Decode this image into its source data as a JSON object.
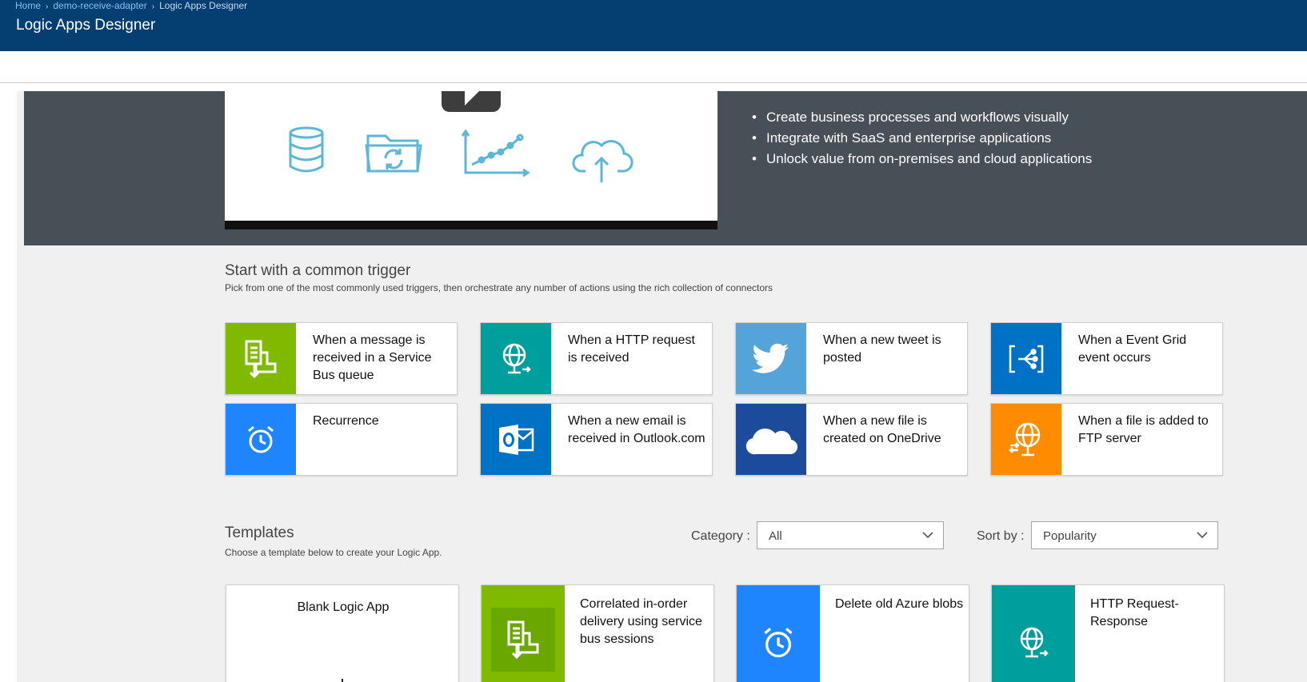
{
  "header": {
    "breadcrumb": [
      {
        "label": "Home"
      },
      {
        "label": "demo-receive-adapter"
      },
      {
        "label": "Logic Apps Designer"
      }
    ],
    "separator": "›",
    "title": "Logic Apps Designer"
  },
  "hero": {
    "bullets": [
      "Create business processes and workflows visually",
      "Integrate with SaaS and enterprise applications",
      "Unlock value from on-premises and cloud applications"
    ],
    "video_icons": [
      "database-icon",
      "folder-sync-icon",
      "chart-line-icon",
      "cloud-upload-icon"
    ],
    "icon_color": "#5bb7d6"
  },
  "triggers": {
    "title": "Start with a common trigger",
    "subtitle": "Pick from one of the most commonly used triggers, then orchestrate any number of actions using the rich collection of connectors",
    "items": [
      {
        "label": "When a message is received in a Service Bus queue",
        "icon": "service-bus-icon",
        "color": "#7fba00"
      },
      {
        "label": "When a HTTP request is received",
        "icon": "http-globe-icon",
        "color": "#009e9c"
      },
      {
        "label": "When a new tweet is posted",
        "icon": "twitter-icon",
        "color": "#55a4d9"
      },
      {
        "label": "When a Event Grid event occurs",
        "icon": "event-grid-icon",
        "color": "#0072c6"
      },
      {
        "label": "Recurrence",
        "icon": "alarm-clock-icon",
        "color": "#1f85ff"
      },
      {
        "label": "When a new email is received in Outlook.com",
        "icon": "outlook-icon",
        "color": "#0072c6"
      },
      {
        "label": "When a new file is created on OneDrive",
        "icon": "onedrive-cloud-icon",
        "color": "#1c4b9c"
      },
      {
        "label": "When a file is added to FTP server",
        "icon": "ftp-globe-icon",
        "color": "#ff8c00"
      }
    ]
  },
  "templates": {
    "title": "Templates",
    "subtitle": "Choose a template below to create your Logic App.",
    "category_label": "Category :",
    "category_value": "All",
    "sort_label": "Sort by :",
    "sort_value": "Popularity",
    "items": [
      {
        "label": "Blank Logic App",
        "icon": "",
        "color": "#ffffff"
      },
      {
        "label": "Correlated in-order delivery using service bus sessions",
        "icon": "service-bus-icon",
        "color": "#7fba00"
      },
      {
        "label": "Delete old Azure blobs",
        "icon": "alarm-clock-icon",
        "color": "#1f85ff"
      },
      {
        "label": "HTTP Request-Response",
        "icon": "http-globe-icon",
        "color": "#009e9c"
      }
    ]
  }
}
